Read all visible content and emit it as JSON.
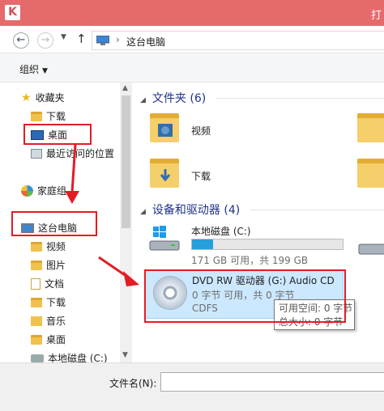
{
  "window": {
    "title": "打",
    "icon_glyph": "K"
  },
  "address": {
    "back": "←",
    "forward": "→",
    "history": "▼",
    "up": "↑",
    "separator": "›",
    "crumb": "这台电脑"
  },
  "toolbar": {
    "organize": "组织",
    "organize_arrow": "▼"
  },
  "nav": {
    "favorites": "收藏夹",
    "downloads": "下载",
    "desktop": "桌面",
    "recent": "最近访问的位置",
    "homegroup": "家庭组",
    "this_pc": "这台电脑",
    "pc_items": [
      "视频",
      "图片",
      "文档",
      "下载",
      "音乐",
      "桌面",
      "本地磁盘 (C:)"
    ]
  },
  "content": {
    "folders_header": "文件夹 (6)",
    "folder_items": [
      "视频",
      "下载"
    ],
    "devices_header": "设备和驱动器 (4)",
    "c_drive": {
      "name": "本地磁盘 (C:)",
      "space": "171 GB 可用，共 199 GB",
      "used_fraction": 0.14
    },
    "dvd": {
      "name": "DVD RW 驱动器 (G:) Audio CD",
      "space": "0 字节 可用，共 0 字节",
      "fs": "CDFS"
    },
    "tooltip": {
      "line1": "可用空间: 0 字节",
      "line2": "总大小: 0 字节"
    }
  },
  "footer": {
    "filename_label": "文件名(N):",
    "filename_value": ""
  },
  "colors": {
    "title_bar": "#e56a6c",
    "highlight": "#e31c24",
    "selection": "#cce8ff",
    "progress": "#26a0da"
  }
}
